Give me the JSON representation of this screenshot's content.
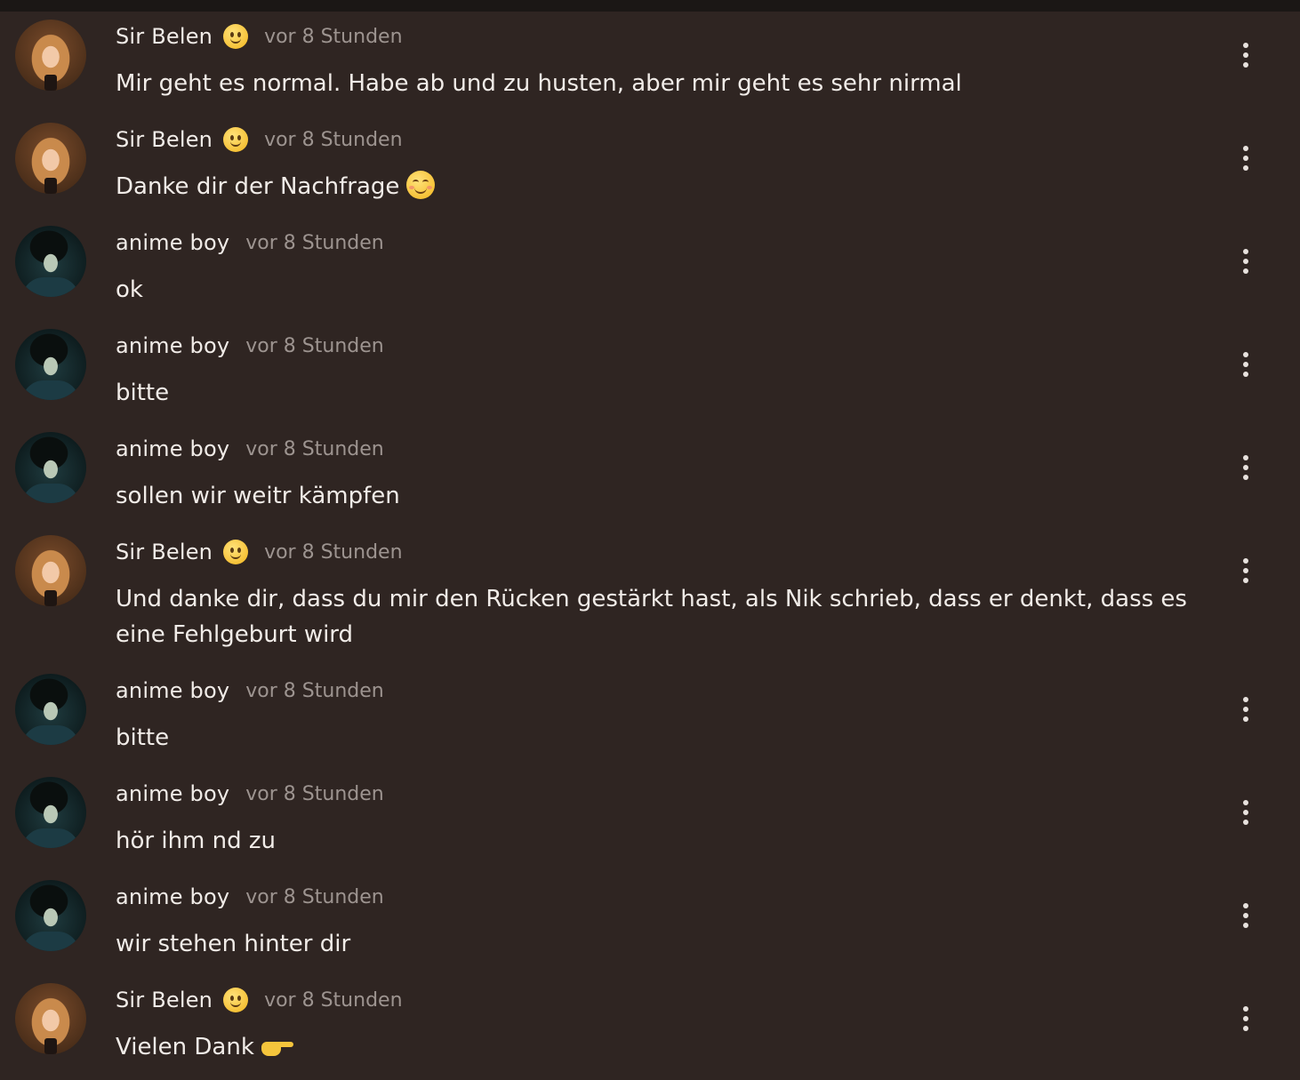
{
  "messages": [
    {
      "author": "Sir Belen",
      "kind": "belen",
      "time": "vor 8 Stunden",
      "text": "Mir geht es normal. Habe ab und zu husten, aber mir geht es sehr nirmal",
      "badge_icon": "slightly-smiling-face-icon"
    },
    {
      "author": "Sir Belen",
      "kind": "belen",
      "time": "vor 8 Stunden",
      "text": "Danke dir der Nachfrage",
      "badge_icon": "slightly-smiling-face-icon",
      "trailing_icon": "smiling-face-with-smiling-eyes-icon"
    },
    {
      "author": "anime boy",
      "kind": "anime",
      "time": "vor 8 Stunden",
      "text": "ok"
    },
    {
      "author": "anime boy",
      "kind": "anime",
      "time": "vor 8 Stunden",
      "text": "bitte"
    },
    {
      "author": "anime boy",
      "kind": "anime",
      "time": "vor 8 Stunden",
      "text": "sollen wir weitr kämpfen"
    },
    {
      "author": "Sir Belen",
      "kind": "belen",
      "time": "vor 8 Stunden",
      "text": "Und danke dir, dass du mir den Rücken gestärkt hast, als Nik schrieb, dass er denkt, dass es eine Fehlgeburt wird",
      "badge_icon": "slightly-smiling-face-icon"
    },
    {
      "author": "anime boy",
      "kind": "anime",
      "time": "vor 8 Stunden",
      "text": "bitte"
    },
    {
      "author": "anime boy",
      "kind": "anime",
      "time": "vor 8 Stunden",
      "text": "hör ihm nd zu"
    },
    {
      "author": "anime boy",
      "kind": "anime",
      "time": "vor 8 Stunden",
      "text": "wir stehen hinter dir"
    },
    {
      "author": "Sir Belen",
      "kind": "belen",
      "time": "vor 8 Stunden",
      "text": "Vielen Dank",
      "badge_icon": "slightly-smiling-face-icon",
      "trailing_icon": "backhand-index-pointing-left-icon"
    }
  ],
  "colors": {
    "background": "#2f2522",
    "text": "#f1ece8",
    "timestamp": "#9d9490"
  }
}
